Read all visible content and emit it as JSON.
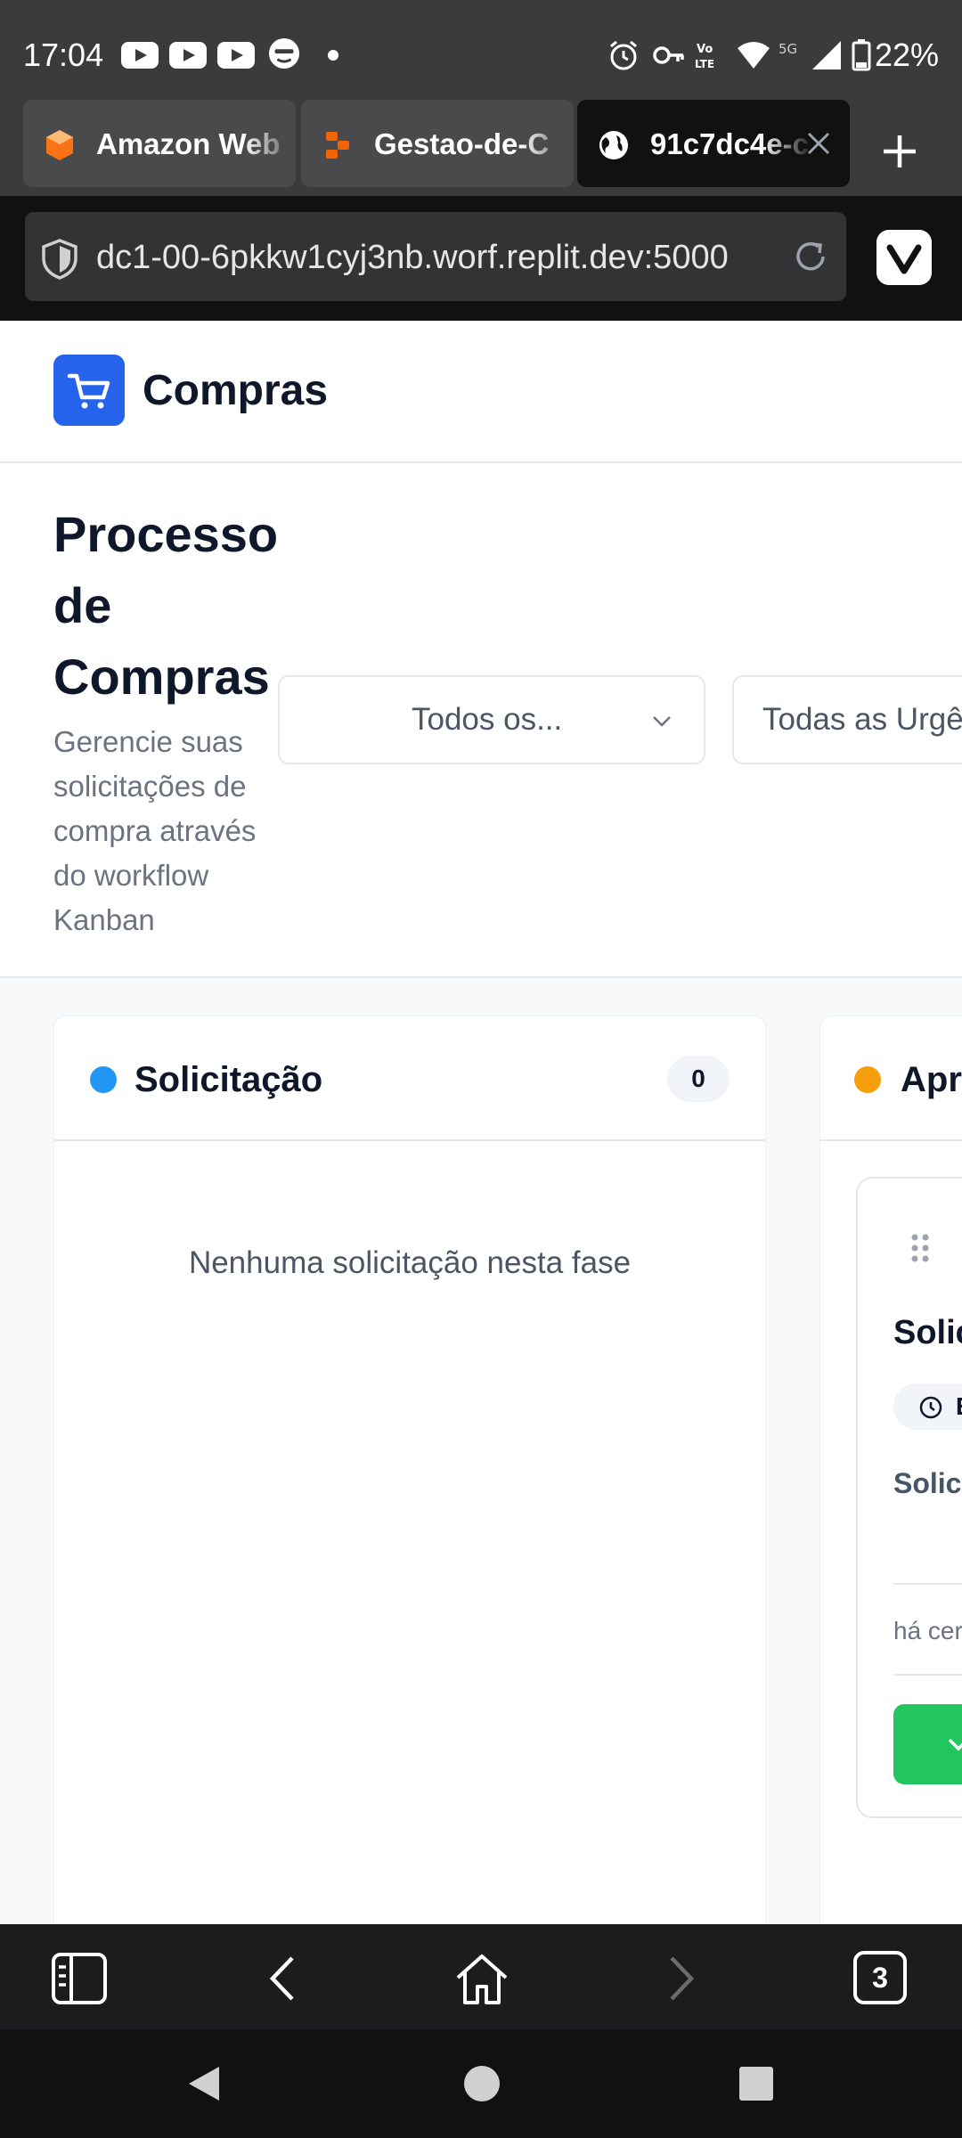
{
  "status_bar": {
    "time": "17:04",
    "battery": "22%",
    "icons": [
      "youtube-icon",
      "youtube-icon",
      "youtube-icon",
      "reddit-icon",
      "alarm-icon",
      "vpn-key-icon",
      "volte-icon",
      "wifi-icon",
      "5g-icon",
      "signal-icon",
      "battery-icon"
    ]
  },
  "tabs": [
    {
      "label": "Amazon Web",
      "icon": "aws-icon"
    },
    {
      "label": "Gestao-de-C",
      "icon": "replit-icon"
    },
    {
      "label": "91c7dc4e-c",
      "icon": "globe-icon",
      "active": true
    }
  ],
  "address_bar": {
    "url": "dc1-00-6pkkw1cyj3nb.worf.replit.dev:5000"
  },
  "app": {
    "title": "Compras",
    "brand_color": "#2563eb"
  },
  "page": {
    "title": "Processo de Compras",
    "subtitle": "Gerencie suas solicitações de compra através do workflow Kanban",
    "filters": [
      {
        "value": "Todos os..."
      },
      {
        "value": "Todas as Urgê"
      }
    ]
  },
  "board": {
    "columns": [
      {
        "title": "Solicitação",
        "count": "0",
        "dot_color": "#2196f3",
        "empty_message": "Nenhuma solicitação nesta fase"
      },
      {
        "title": "Apro",
        "dot_color": "#f59e0b"
      }
    ],
    "card": {
      "title": "Solic",
      "badge": "E",
      "description": "Solic Aprov",
      "time": "há cer",
      "action_color": "#22c55e"
    }
  },
  "bottom_toolbar": {
    "tab_count": "3"
  }
}
